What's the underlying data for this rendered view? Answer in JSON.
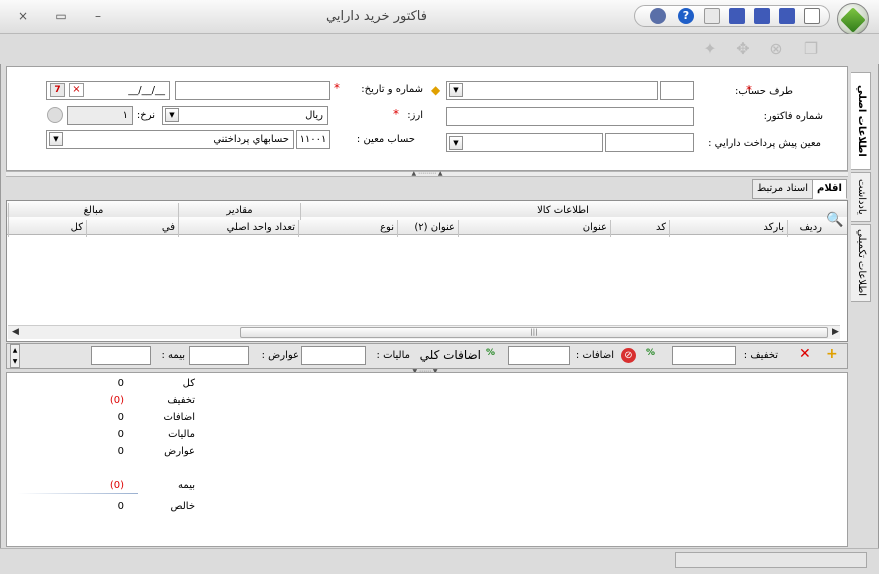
{
  "window": {
    "title": "فاكتور خريد دارايي",
    "close_glyph": "×",
    "maximize_glyph": "▭",
    "minimize_glyph": "–"
  },
  "header_form": {
    "party_label": "طرف حساب:",
    "number_date_label": "شماره و تاريخ:",
    "invoice_no_label": "شماره فاكتور:",
    "currency_label": "ارز:",
    "currency_value": "ريال",
    "rate_label": "نرخ:",
    "rate_value": "۱",
    "date_value": "__/__/__",
    "prepay_label": "معين پيش پرداخت دارايي :",
    "ledger_label": "حساب معين :",
    "ledger_code": "۱۱۰۰۱",
    "ledger_name": "حسابهاي پرداختني"
  },
  "side_tabs": [
    "اطلاعات اصلي",
    "يادداشت",
    "اطلاعات تكميلي"
  ],
  "tabs": [
    "اقلام",
    "اسناد مرتبط"
  ],
  "grid": {
    "group_headers": [
      "اطلاعات كالا",
      "مقادير",
      "مبالغ"
    ],
    "columns": [
      "رديف",
      "باركد",
      "كد",
      "عنوان",
      "عنوان (٢)",
      "نوع",
      "تعداد واحد اصلي",
      "في",
      "كل"
    ]
  },
  "fees": {
    "discount_label": "تخفيف :",
    "additions_label": "اضافات :",
    "total_additions_label": "اضافات كلي",
    "tax_label": "ماليات :",
    "duties_label": "عوارض :",
    "insurance_label": "بيمه :"
  },
  "summary": [
    {
      "label": "كل",
      "value": "0",
      "highlight": false
    },
    {
      "label": "تخفيف",
      "value": "(0)",
      "highlight": true
    },
    {
      "label": "اضافات",
      "value": "0",
      "highlight": false
    },
    {
      "label": "ماليات",
      "value": "0",
      "highlight": false
    },
    {
      "label": "عوارض",
      "value": "0",
      "highlight": false
    },
    {
      "label": "بيمه",
      "value": "(0)",
      "highlight": true
    },
    {
      "label": "خالص",
      "value": "0",
      "highlight": false
    }
  ],
  "colors": {
    "required": "#dd0000",
    "accent": "#2f7a1a"
  }
}
